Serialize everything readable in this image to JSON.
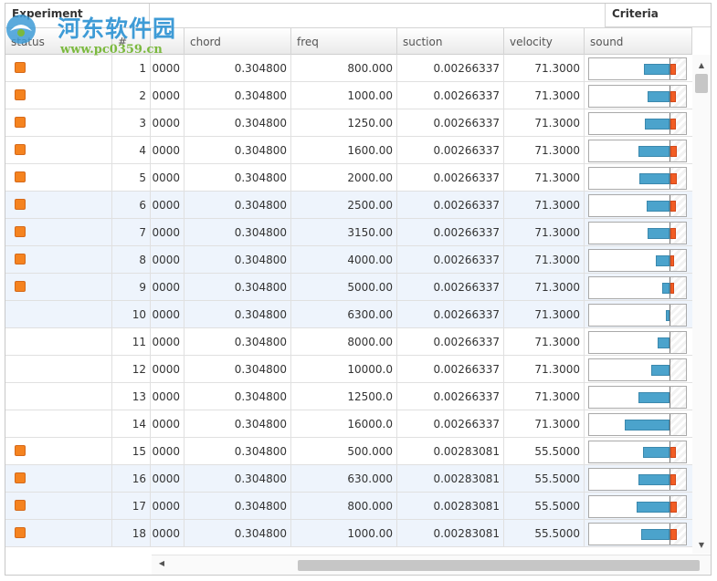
{
  "grid": {
    "groups": {
      "experiment": "Experiment",
      "criteria": "Criteria"
    },
    "columns": [
      "status",
      "#",
      "",
      "chord",
      "freq",
      "suction",
      "velocity",
      "sound"
    ],
    "rows": [
      {
        "index": "1",
        "aoa": "0000",
        "chord": "0.304800",
        "freq": "800.000",
        "suction": "0.00266337",
        "velocity": "71.3000",
        "status": true,
        "sound_blue": 0.32,
        "sound_orange": 0.07
      },
      {
        "index": "2",
        "aoa": "0000",
        "chord": "0.304800",
        "freq": "1000.00",
        "suction": "0.00266337",
        "velocity": "71.3000",
        "status": true,
        "sound_blue": 0.27,
        "sound_orange": 0.07
      },
      {
        "index": "3",
        "aoa": "0000",
        "chord": "0.304800",
        "freq": "1250.00",
        "suction": "0.00266337",
        "velocity": "71.3000",
        "status": true,
        "sound_blue": 0.31,
        "sound_orange": 0.07
      },
      {
        "index": "4",
        "aoa": "0000",
        "chord": "0.304800",
        "freq": "1600.00",
        "suction": "0.00266337",
        "velocity": "71.3000",
        "status": true,
        "sound_blue": 0.39,
        "sound_orange": 0.08
      },
      {
        "index": "5",
        "aoa": "0000",
        "chord": "0.304800",
        "freq": "2000.00",
        "suction": "0.00266337",
        "velocity": "71.3000",
        "status": true,
        "sound_blue": 0.37,
        "sound_orange": 0.08
      },
      {
        "index": "6",
        "aoa": "0000",
        "chord": "0.304800",
        "freq": "2500.00",
        "suction": "0.00266337",
        "velocity": "71.3000",
        "status": true,
        "sound_blue": 0.28,
        "sound_orange": 0.07
      },
      {
        "index": "7",
        "aoa": "0000",
        "chord": "0.304800",
        "freq": "3150.00",
        "suction": "0.00266337",
        "velocity": "71.3000",
        "status": true,
        "sound_blue": 0.27,
        "sound_orange": 0.07
      },
      {
        "index": "8",
        "aoa": "0000",
        "chord": "0.304800",
        "freq": "4000.00",
        "suction": "0.00266337",
        "velocity": "71.3000",
        "status": true,
        "sound_blue": 0.17,
        "sound_orange": 0.05
      },
      {
        "index": "9",
        "aoa": "0000",
        "chord": "0.304800",
        "freq": "5000.00",
        "suction": "0.00266337",
        "velocity": "71.3000",
        "status": true,
        "sound_blue": 0.09,
        "sound_orange": 0.04
      },
      {
        "index": "10",
        "aoa": "0000",
        "chord": "0.304800",
        "freq": "6300.00",
        "suction": "0.00266337",
        "velocity": "71.3000",
        "status": false,
        "sound_blue": 0.04,
        "sound_orange": 0
      },
      {
        "index": "11",
        "aoa": "0000",
        "chord": "0.304800",
        "freq": "8000.00",
        "suction": "0.00266337",
        "velocity": "71.3000",
        "status": false,
        "sound_blue": 0.15,
        "sound_orange": 0
      },
      {
        "index": "12",
        "aoa": "0000",
        "chord": "0.304800",
        "freq": "10000.0",
        "suction": "0.00266337",
        "velocity": "71.3000",
        "status": false,
        "sound_blue": 0.23,
        "sound_orange": 0
      },
      {
        "index": "13",
        "aoa": "0000",
        "chord": "0.304800",
        "freq": "12500.0",
        "suction": "0.00266337",
        "velocity": "71.3000",
        "status": false,
        "sound_blue": 0.39,
        "sound_orange": 0
      },
      {
        "index": "14",
        "aoa": "0000",
        "chord": "0.304800",
        "freq": "16000.0",
        "suction": "0.00266337",
        "velocity": "71.3000",
        "status": false,
        "sound_blue": 0.56,
        "sound_orange": 0
      },
      {
        "index": "15",
        "aoa": "0000",
        "chord": "0.304800",
        "freq": "500.000",
        "suction": "0.00283081",
        "velocity": "55.5000",
        "status": true,
        "sound_blue": 0.33,
        "sound_orange": 0.07
      },
      {
        "index": "16",
        "aoa": "0000",
        "chord": "0.304800",
        "freq": "630.000",
        "suction": "0.00283081",
        "velocity": "55.5000",
        "status": true,
        "sound_blue": 0.39,
        "sound_orange": 0.07
      },
      {
        "index": "17",
        "aoa": "0000",
        "chord": "0.304800",
        "freq": "800.000",
        "suction": "0.00283081",
        "velocity": "55.5000",
        "status": true,
        "sound_blue": 0.41,
        "sound_orange": 0.08
      },
      {
        "index": "18",
        "aoa": "0000",
        "chord": "0.304800",
        "freq": "1000.00",
        "suction": "0.00283081",
        "velocity": "55.5000",
        "status": true,
        "sound_blue": 0.35,
        "sound_orange": 0.08
      }
    ]
  },
  "watermark": {
    "title": "河东软件园",
    "url": "www.pc0359.cn"
  },
  "colors": {
    "status": "#f5831f",
    "sound_blue": "#4ba3cc",
    "sound_orange": "#f25d23",
    "alt_row": "#eef4fc"
  },
  "icons": {
    "scroll_up": "triangle-up-icon",
    "scroll_down": "triangle-down-icon",
    "scroll_left": "triangle-left-icon"
  }
}
